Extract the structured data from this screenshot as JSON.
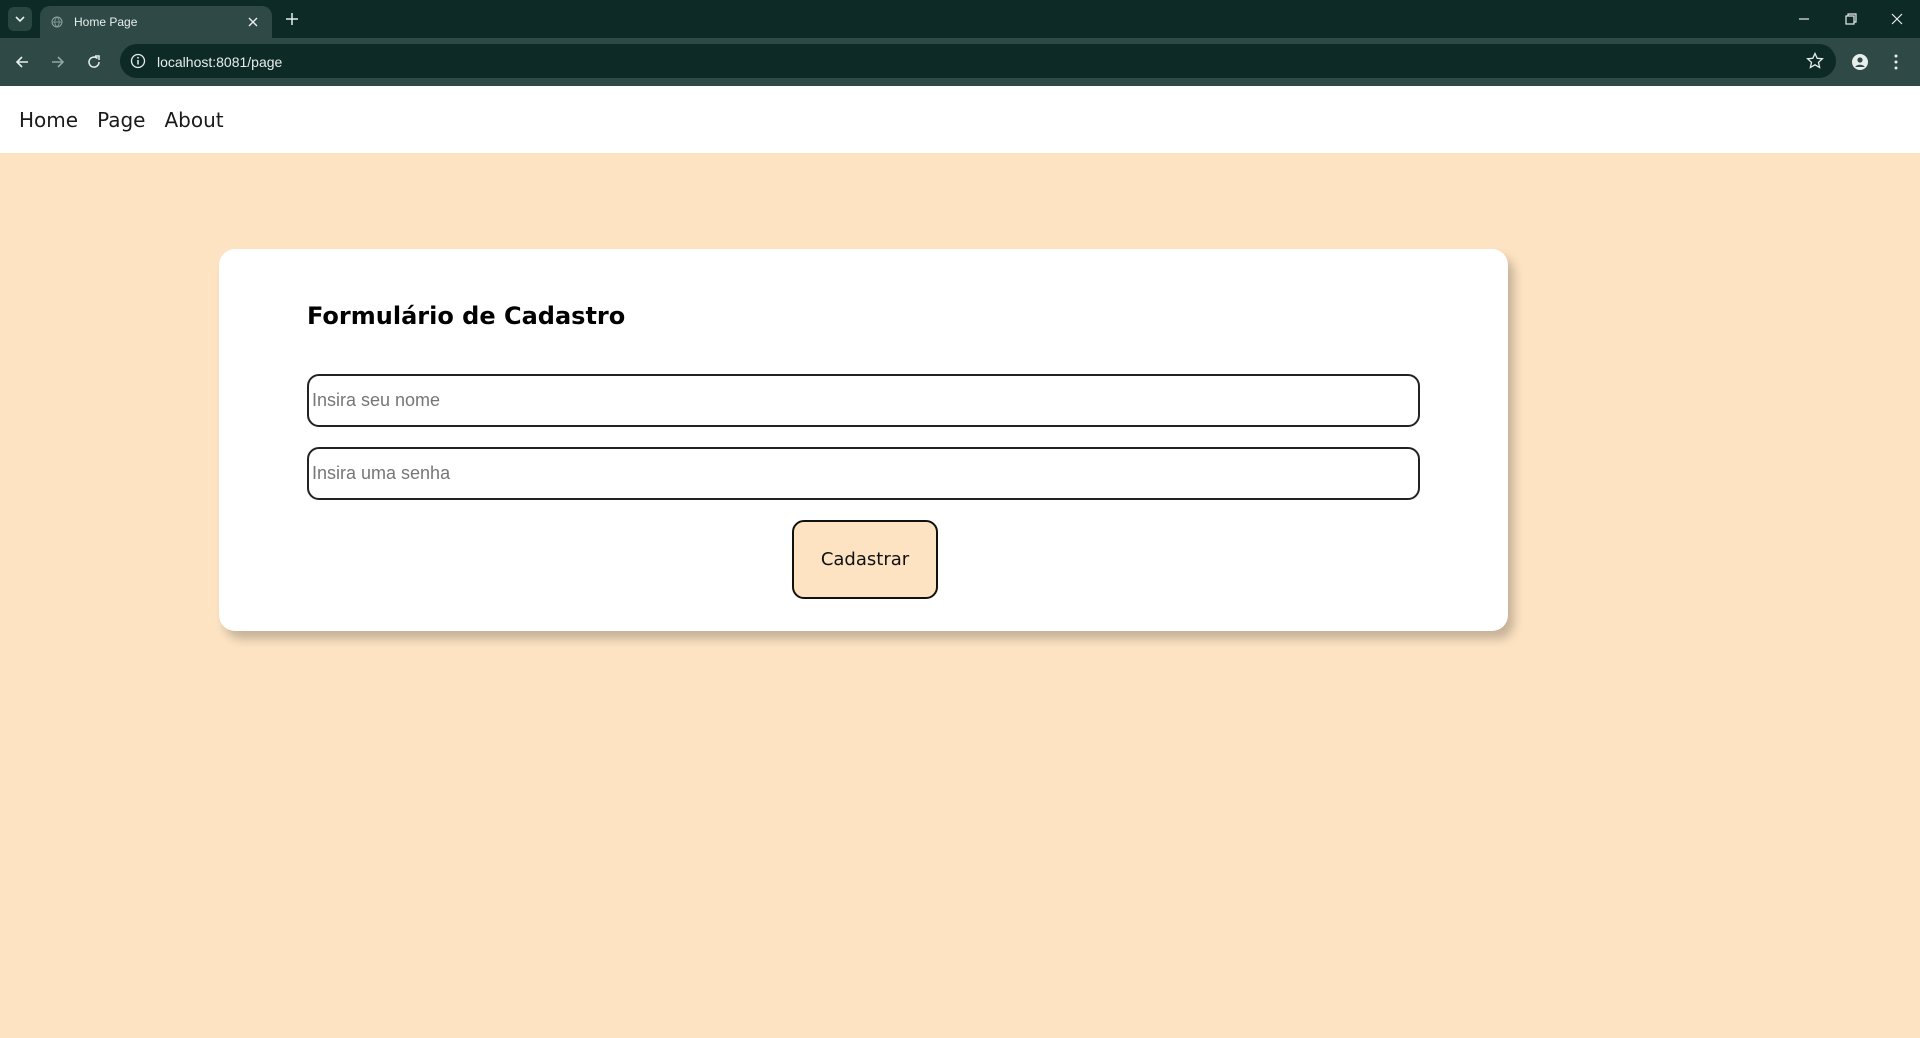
{
  "browser": {
    "tab_title": "Home Page",
    "url": "localhost:8081/page"
  },
  "nav": {
    "links": [
      "Home",
      "Page",
      "About"
    ]
  },
  "form": {
    "title": "Formulário de Cadastro",
    "name_placeholder": "Insira seu nome",
    "password_placeholder": "Insira uma senha",
    "submit_label": "Cadastrar"
  },
  "colors": {
    "page_background": "#fde3c2",
    "browser_frame": "#0e2a26",
    "toolbar": "#2f4a46",
    "button_background": "#fde3c2"
  }
}
